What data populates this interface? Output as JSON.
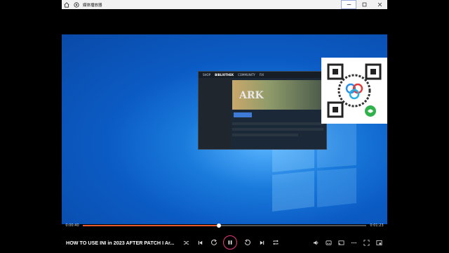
{
  "app": {
    "title": "媒体播放器"
  },
  "video": {
    "title": "HOW TO USE INI in 2023 AFTER PATCH I Ar...",
    "time_current": "0:00:40",
    "time_total": "0:01:23",
    "progress": 0.48,
    "state": "playing"
  },
  "desktop": {
    "steam_window": {
      "nav": [
        "SHOP",
        "BIBLIOTHEK",
        "COMMUNITY",
        "FIX"
      ],
      "game_title": "ARK"
    }
  },
  "colors": {
    "accent": "#e65a2f",
    "play_ring": "#e93a7e"
  },
  "icons": {
    "home": "home-icon",
    "media": "media-player-icon",
    "minimize": "minimize-icon",
    "maximize": "maximize-icon",
    "close": "close-icon",
    "shuffle": "shuffle-icon",
    "prev": "previous-icon",
    "rewind": "rewind-icon",
    "pause": "pause-icon",
    "forward": "forward-icon",
    "next": "next-icon",
    "repeat": "repeat-icon",
    "volume": "volume-icon",
    "captions": "captions-icon",
    "cast": "cast-icon",
    "more": "more-icon",
    "fullscreen": "fullscreen-icon",
    "miniplayer": "miniplayer-icon"
  }
}
